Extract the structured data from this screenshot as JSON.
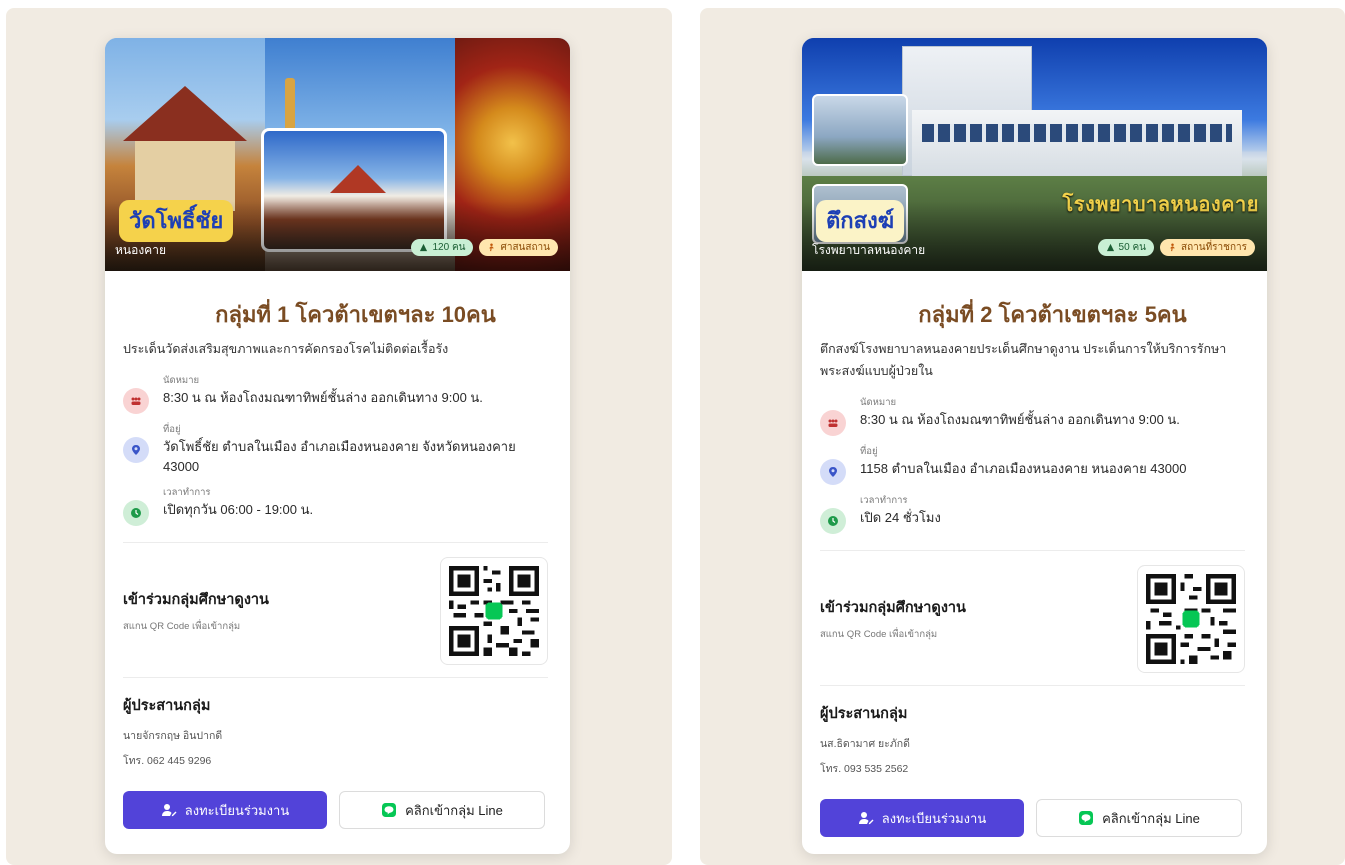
{
  "cards": [
    {
      "place_name": "วัดโพธิ์ชัย",
      "place_sub": "หนองคาย",
      "badge_count": "120 คน",
      "badge_type": "ศาสนสถาน",
      "title": "กลุ่มที่ 1 โควต้าเขตฯละ 10คน",
      "description": "ประเด็นวัดส่งเสริมสุขภาพและการคัดกรองโรคไม่ติดต่อเรื้อรัง",
      "info": [
        {
          "label": "นัดหมาย",
          "value": "8:30 น ณ ห้องโถงมณฑาทิพย์ชั้นล่าง ออกเดินทาง 9:00 น.",
          "icon": "group-icon"
        },
        {
          "label": "ที่อยู่",
          "value": "วัดโพธิ์ชัย ตำบลในเมือง อำเภอเมืองหนองคาย จังหวัดหนองคาย 43000",
          "icon": "location-pin-icon"
        },
        {
          "label": "เวลาทำการ",
          "value": "เปิดทุกวัน 06:00 - 19:00 น.",
          "icon": "clock-icon"
        }
      ],
      "join_title": "เข้าร่วมกลุ่มศึกษาดูงาน",
      "join_sub": "สแกน QR Code เพื่อเข้ากลุ่ม",
      "coord_title": "ผู้ประสานกลุ่ม",
      "coord_name": "นายจักรกฤษ อินปากดี",
      "coord_phone": "โทร. 062 445 9296",
      "register_label": "ลงทะเบียนร่วมงาน",
      "line_label": "คลิกเข้ากลุ่ม Line"
    },
    {
      "place_name": "ตึกสงฆ์",
      "place_sub": "โรงพยาบาลหนองคาย",
      "hero_sign": "โรงพยาบาลหนองคาย",
      "badge_count": "50 คน",
      "badge_type": "สถานที่ราชการ",
      "title": "กลุ่มที่ 2 โควต้าเขตฯละ 5คน",
      "description": "ตึกสงฆ์โรงพยาบาลหนองคายประเด็นศึกษาดูงาน ประเด็นการให้บริการรักษาพระสงฆ์แบบผู้ป่วยใน",
      "info": [
        {
          "label": "นัดหมาย",
          "value": "8:30 น ณ ห้องโถงมณฑาทิพย์ชั้นล่าง ออกเดินทาง 9:00 น.",
          "icon": "group-icon"
        },
        {
          "label": "ที่อยู่",
          "value": "1158 ตำบลในเมือง อำเภอเมืองหนองคาย หนองคาย 43000",
          "icon": "location-pin-icon"
        },
        {
          "label": "เวลาทำการ",
          "value": "เปิด 24 ชั่วโมง",
          "icon": "clock-icon"
        }
      ],
      "join_title": "เข้าร่วมกลุ่มศึกษาดูงาน",
      "join_sub": "สแกน QR Code เพื่อเข้ากลุ่ม",
      "coord_title": "ผู้ประสานกลุ่ม",
      "coord_name": "นส.ธิดามาศ ยะภักดี",
      "coord_phone": "โทร. 093 535 2562",
      "register_label": "ลงทะเบียนร่วมงาน",
      "line_label": "คลิกเข้ากลุ่ม Line"
    }
  ],
  "colors": {
    "accent": "#5243d9",
    "title": "#7a4c23",
    "place_tag_blue": "#1d3fb5",
    "line_green": "#06c755",
    "panel_bg": "#f1ebe2"
  }
}
